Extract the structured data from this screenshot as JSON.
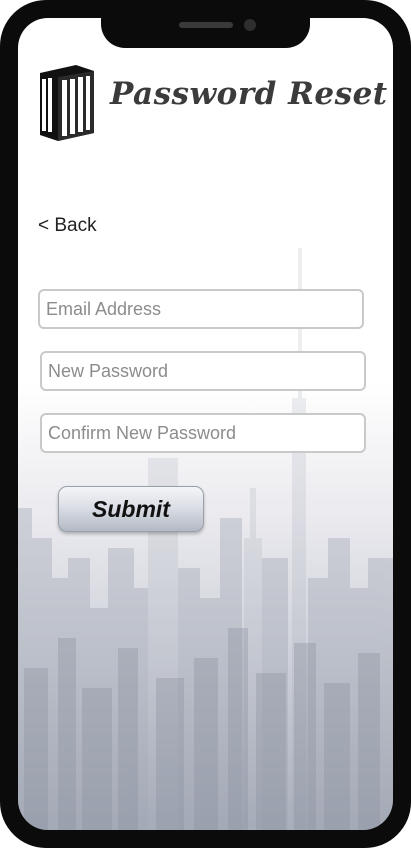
{
  "app": {
    "title": "Password Reset"
  },
  "nav": {
    "back_label": "< Back"
  },
  "form": {
    "email_placeholder": "Email Address",
    "new_password_placeholder": "New Password",
    "confirm_password_placeholder": "Confirm New Password",
    "submit_label": "Submit"
  },
  "icons": {
    "logo": "building-icon",
    "back": "chevron-left"
  },
  "colors": {
    "phone_frame": "#0b0b0b",
    "title_text": "#3b3b3b",
    "field_border": "#c9c9c9",
    "placeholder": "#8c8c8c",
    "skyline": "#9aa0ad"
  }
}
